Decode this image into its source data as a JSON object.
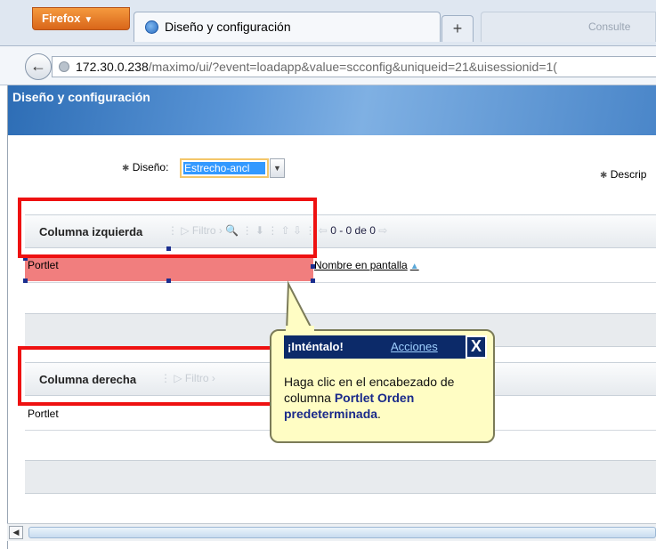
{
  "browser": {
    "menu_button": "Firefox",
    "tab_title": "Diseño y configuración",
    "new_tab": "+",
    "ghost_tab": "Consulte",
    "url_host": "172.30.0.238",
    "url_path": "/maximo/ui/?event=loadapp&value=scconfig&uniqueid=21&uisessionid=1("
  },
  "app": {
    "title": "Diseño y configuración"
  },
  "form": {
    "design_label": "Diseño:",
    "design_value": "Estrecho-ancl",
    "description_label": "Descrip"
  },
  "left_table": {
    "name": "Columna izquierda",
    "filter": "Filtro",
    "count": "0 - 0 de 0",
    "col1": "Portlet",
    "col2": "Nombre en pantalla"
  },
  "right_table": {
    "name": "Columna derecha",
    "filter": "Filtro",
    "col1": "Portlet"
  },
  "tooltip": {
    "title": "¡Inténtalo!",
    "actions": "Acciones",
    "close": "X",
    "body_pre": "Haga clic en el encabezado de columna ",
    "body_bold": "Portlet Orden predeterminada",
    "body_post": "."
  },
  "colors": {
    "highlight_red": "#ee1111",
    "tooltip_bg": "#fffdc4",
    "tooltip_header": "#0c2a69"
  }
}
